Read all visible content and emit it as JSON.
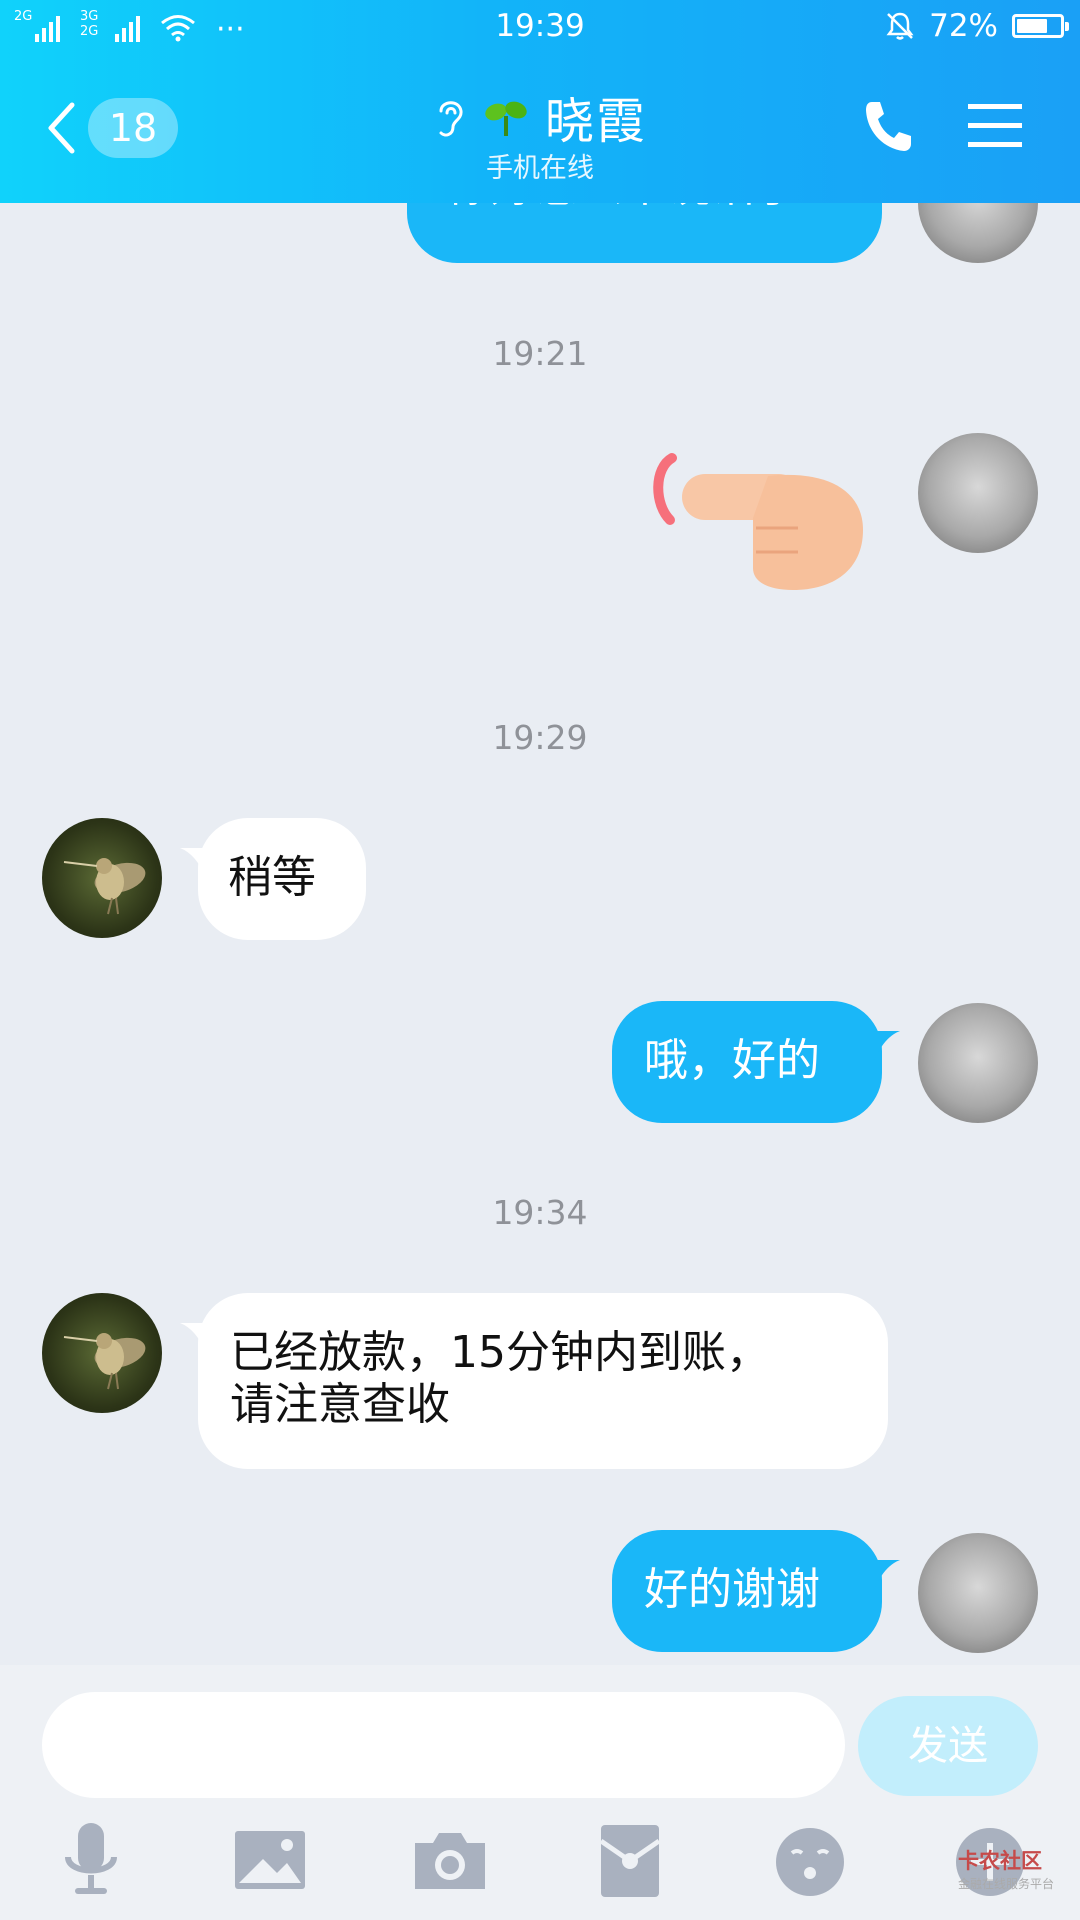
{
  "status_bar": {
    "sim1_label": "2G",
    "sim2_label_top": "3G",
    "sim2_label_bottom": "2G",
    "more": "···",
    "time": "19:39",
    "battery_percent": "72%",
    "battery_level": 0.72
  },
  "header": {
    "back_count": "18",
    "title": "晓霞",
    "subtitle": "手机在线"
  },
  "messages": {
    "partial_top": "你好怎么不说话了",
    "ts1": "19:21",
    "ts2": "19:29",
    "m1_text": "稍等",
    "m2_text": "哦，好的",
    "ts3": "19:34",
    "m3_line1": "已经放款，15分钟内到账，",
    "m3_line2": "请注意查收",
    "m4_text": "好的谢谢"
  },
  "input": {
    "placeholder": "",
    "send_label": "发送"
  },
  "toolbar": {
    "icons": [
      "microphone-icon",
      "image-icon",
      "camera-icon",
      "red-packet-icon",
      "emoji-icon",
      "plus-icon"
    ]
  },
  "watermark": {
    "main": "卡农社区",
    "sub": "金融在线服务平台"
  },
  "colors": {
    "header_gradient_start": "#10d2fb",
    "header_gradient_end": "#1aa0f6",
    "outgoing_bubble": "#1ab7f8",
    "incoming_bubble": "#ffffff",
    "chat_background": "#e9edf3"
  }
}
